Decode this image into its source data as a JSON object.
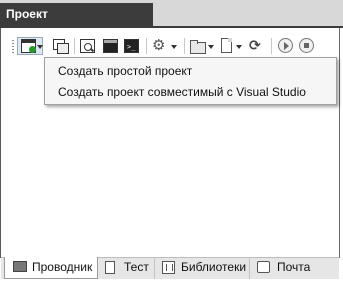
{
  "panel": {
    "title": "Проект"
  },
  "toolbar": {
    "buttons": [
      {
        "icon": "new-project-icon",
        "has_dropdown": true
      },
      {
        "icon": "windows-icon",
        "has_dropdown": false
      },
      {
        "icon": "preview-icon",
        "has_dropdown": false
      },
      {
        "icon": "console-icon",
        "has_dropdown": false
      },
      {
        "icon": "run-console-icon",
        "has_dropdown": false
      },
      {
        "icon": "settings-gear-icon",
        "has_dropdown": true
      },
      {
        "icon": "open-folder-icon",
        "has_dropdown": true
      },
      {
        "icon": "new-file-icon",
        "has_dropdown": true
      },
      {
        "icon": "refresh-icon",
        "has_dropdown": false
      },
      {
        "icon": "play-icon",
        "has_dropdown": false
      },
      {
        "icon": "stop-icon",
        "has_dropdown": false
      }
    ]
  },
  "dropdown_menu": {
    "items": [
      {
        "label": "Создать простой проект"
      },
      {
        "label": "Создать проект совместимый с Visual Studio"
      }
    ]
  },
  "bottom_tabs": [
    {
      "label": "Проводник",
      "icon": "explorer-icon",
      "active": true
    },
    {
      "label": "Тест",
      "icon": "test-document-icon",
      "active": false
    },
    {
      "label": "Библиотеки",
      "icon": "libraries-icon",
      "active": false
    },
    {
      "label": "Почта",
      "icon": "mail-icon",
      "active": false
    }
  ],
  "colors": {
    "title_tab_bg": "#3c3c3c",
    "menu_bg": "#f6f6f6",
    "tabs_bar_bg": "#e6e6e6"
  }
}
